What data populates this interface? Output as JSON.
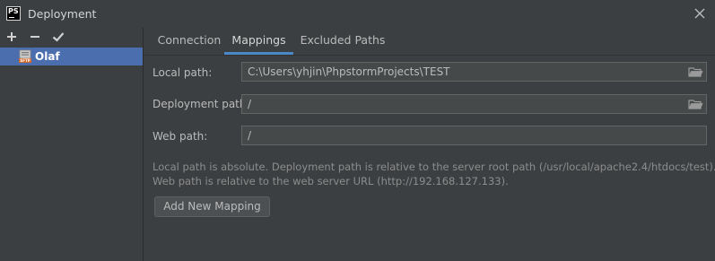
{
  "window": {
    "title": "Deployment",
    "app_icon_label": "PS"
  },
  "toolbar": {
    "add_icon": "plus-icon",
    "remove_icon": "minus-icon",
    "default_icon": "check-icon"
  },
  "servers": [
    {
      "name": "Olaf",
      "icon": "sftp-server-icon",
      "selected": true
    }
  ],
  "tabs": [
    {
      "label": "Connection",
      "active": false
    },
    {
      "label": "Mappings",
      "active": true
    },
    {
      "label": "Excluded Paths",
      "active": false
    }
  ],
  "mappings": {
    "local_path_label": "Local path:",
    "local_path_value": "C:\\Users\\yhjin\\PhpstormProjects\\TEST",
    "deployment_path_label": "Deployment path:",
    "deployment_path_value": "/",
    "web_path_label": "Web path:",
    "web_path_value": "/",
    "help_line1": "Local path is absolute. Deployment path is relative to the server root path (/usr/local/apache2.4/htdocs/test).",
    "help_line2": "Web path is relative to the web server URL (http://192.168.127.133).",
    "add_button_label": "Add New Mapping"
  },
  "colors": {
    "background": "#3c3f41",
    "selection": "#4b6eaf",
    "tab_underline": "#4a88c7",
    "field_background": "#45494a"
  }
}
